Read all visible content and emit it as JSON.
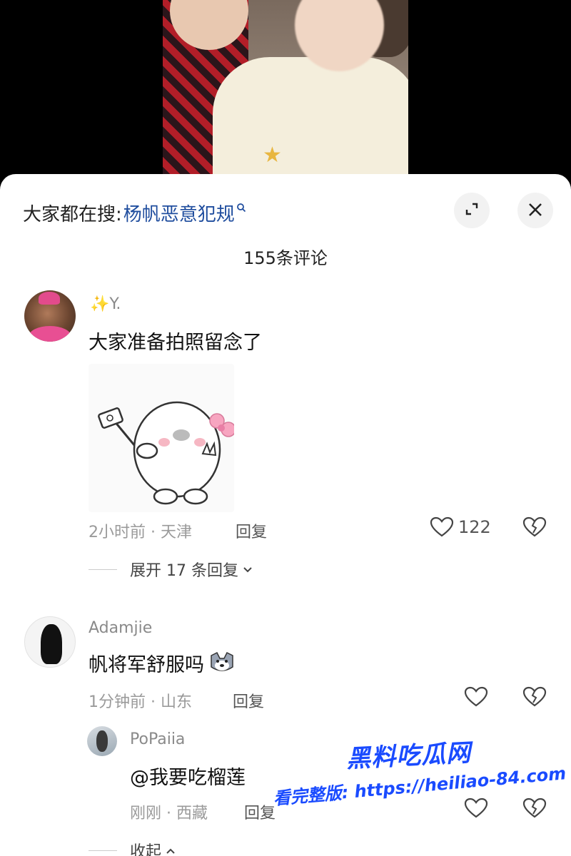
{
  "search": {
    "prefix": "大家都在搜:",
    "keyword": "杨帆恶意犯规"
  },
  "comments_count_label": "155条评论",
  "comments": [
    {
      "username": "✨Y.",
      "text": "大家准备拍照留念了",
      "time_location": "2小时前 · 天津",
      "reply_label": "回复",
      "likes": "122",
      "expand_label": "展开 17 条回复"
    },
    {
      "username": "Adamjie",
      "text": "帆将军舒服吗",
      "time_location": "1分钟前 · 山东",
      "reply_label": "回复"
    }
  ],
  "reply": {
    "username": "PoPaiia",
    "text": "@我要吃榴莲",
    "time_location": "刚刚 · 西藏",
    "reply_label": "回复",
    "collapse_label": "收起"
  },
  "watermark": {
    "brand": "黑料吃瓜网",
    "tagline": "看完整版: https://heiliao-84.com"
  },
  "icons": {
    "search": "search-icon",
    "expand": "expand-icon",
    "close": "close-icon",
    "like": "heart-icon",
    "dislike": "broken-heart-icon"
  }
}
